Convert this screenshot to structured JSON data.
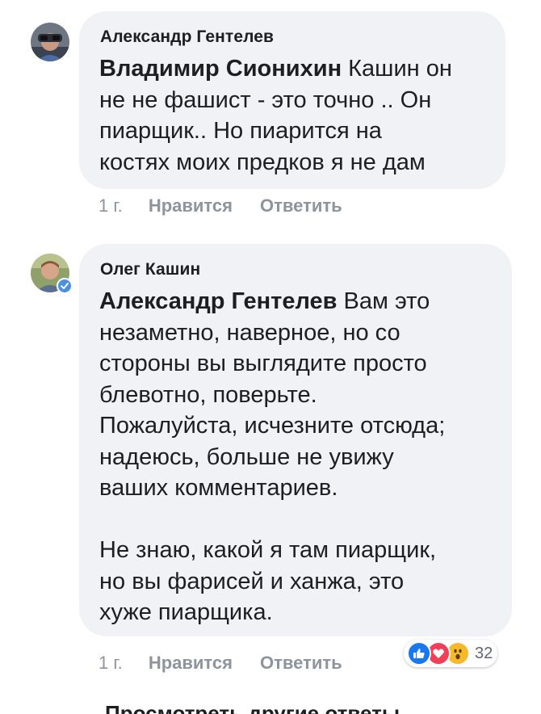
{
  "comments": [
    {
      "author": "Александр Гентелев",
      "mention": "Владимир Сионихин",
      "text": " Кашин он\nне не  фашист - это точно .. Он\nпиарщик.. Но пиарится на\nкостях моих предков я не  дам",
      "time": "1 г.",
      "like_label": "Нравится",
      "reply_label": "Ответить"
    },
    {
      "author": "Олег Кашин",
      "mention": "Александр Гентелев",
      "text": " Вам это\nнезаметно, наверное, но со\nстороны вы выглядите просто\nблевотно, поверьте.\nПожалуйста, исчезните отсюда;\nнадеюсь, больше не увижу\nваших комментариев.\n\nНе знаю, какой я там пиарщик,\nно вы фарисей и ханжа, это\nхуже пиарщика.",
      "time": "1 г.",
      "like_label": "Нравится",
      "reply_label": "Ответить",
      "verified": true,
      "reactions": {
        "icons": [
          "like-icon",
          "love-icon",
          "wow-icon"
        ],
        "colors": {
          "like": "#1877f2",
          "love": "#f33e58",
          "wow": "#f7b928"
        },
        "count": "32"
      }
    }
  ],
  "more_replies_label": "Просмотреть другие ответы"
}
